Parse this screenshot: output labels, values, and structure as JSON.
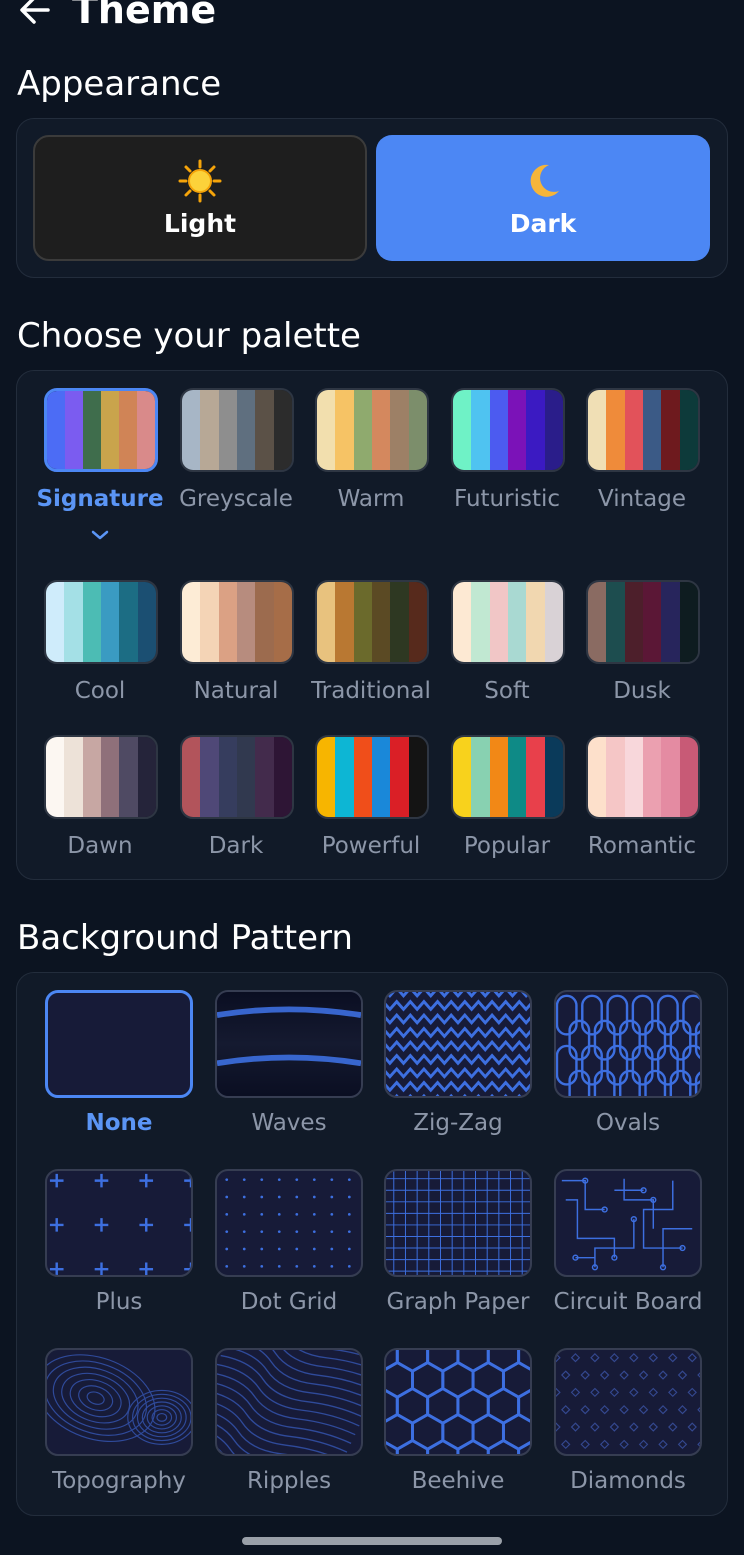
{
  "header": {
    "title": "Theme",
    "back_icon": "arrow-left-icon"
  },
  "appearance": {
    "title": "Appearance",
    "options": [
      {
        "label": "Light",
        "icon": "sun-icon",
        "selected": false
      },
      {
        "label": "Dark",
        "icon": "crescent-moon-icon",
        "selected": true
      }
    ]
  },
  "palette": {
    "title": "Choose your palette",
    "items": [
      {
        "label": "Signature",
        "selected": true,
        "colors": [
          "#4c6cf5",
          "#7b5cf0",
          "#3f6d4c",
          "#c9a44c",
          "#d08456",
          "#d98a8a"
        ]
      },
      {
        "label": "Greyscale",
        "colors": [
          "#a7b6c6",
          "#b7a896",
          "#8e8e8e",
          "#5f6f7f",
          "#5b5147",
          "#2c2c2c"
        ]
      },
      {
        "label": "Warm",
        "colors": [
          "#f2dfae",
          "#f6c365",
          "#8faa6e",
          "#d4885e",
          "#9d8066",
          "#7c8e6b"
        ]
      },
      {
        "label": "Futuristic",
        "colors": [
          "#6ff2c6",
          "#4fc3f1",
          "#4c5bf0",
          "#7b12b8",
          "#3b1ac2",
          "#2a1d8a"
        ]
      },
      {
        "label": "Vintage",
        "colors": [
          "#f0dfb5",
          "#ef8b3a",
          "#e2525a",
          "#3b5a86",
          "#6e1a1e",
          "#0d3a3a"
        ]
      },
      {
        "label": "Cool",
        "colors": [
          "#cfecfb",
          "#a4e0e6",
          "#4cbcb4",
          "#3a9bc2",
          "#1c6d84",
          "#1b4f72"
        ]
      },
      {
        "label": "Natural",
        "colors": [
          "#fdecd6",
          "#f4d4b6",
          "#dba184",
          "#b78c7e",
          "#9c6b4e",
          "#a66d48"
        ]
      },
      {
        "label": "Traditional",
        "colors": [
          "#e8c27e",
          "#b97832",
          "#6b6a2c",
          "#5b4a24",
          "#2e3822",
          "#572a1c"
        ]
      },
      {
        "label": "Soft",
        "colors": [
          "#fde9d3",
          "#c1e8d2",
          "#f1c6c6",
          "#a9d9d2",
          "#f1d7b0",
          "#d9d2d6"
        ]
      },
      {
        "label": "Dusk",
        "colors": [
          "#8a6b62",
          "#1d4d4f",
          "#4d1f2b",
          "#5b1736",
          "#27255c",
          "#0e1c20"
        ]
      },
      {
        "label": "Dawn",
        "colors": [
          "#fcf7f2",
          "#ede2d8",
          "#c7a7a3",
          "#8f707a",
          "#4f4a63",
          "#25243a"
        ]
      },
      {
        "label": "Dark",
        "colors": [
          "#b2545b",
          "#4f4877",
          "#363d5e",
          "#31394f",
          "#432b4c",
          "#2e1535"
        ]
      },
      {
        "label": "Powerful",
        "colors": [
          "#f7b500",
          "#0db6d4",
          "#f04e1a",
          "#1a88d9",
          "#da1f26",
          "#141414"
        ]
      },
      {
        "label": "Popular",
        "colors": [
          "#f8d21c",
          "#88d1b1",
          "#f28816",
          "#0e8a86",
          "#e8404b",
          "#0a3a5a"
        ]
      },
      {
        "label": "Romantic",
        "colors": [
          "#fde0cb",
          "#f5c6c6",
          "#f8d7db",
          "#eba0b0",
          "#e48ba2",
          "#c85a76"
        ]
      }
    ]
  },
  "pattern": {
    "title": "Background Pattern",
    "items": [
      {
        "label": "None",
        "selected": true
      },
      {
        "label": "Waves"
      },
      {
        "label": "Zig-Zag"
      },
      {
        "label": "Ovals"
      },
      {
        "label": "Plus"
      },
      {
        "label": "Dot Grid"
      },
      {
        "label": "Graph Paper"
      },
      {
        "label": "Circuit Board"
      },
      {
        "label": "Topography"
      },
      {
        "label": "Ripples"
      },
      {
        "label": "Beehive"
      },
      {
        "label": "Diamonds"
      }
    ]
  },
  "colors": {
    "accent": "#4c87f4",
    "background": "#0c1421",
    "card": "#111a28",
    "pattern_bg": "#171b38",
    "pattern_line": "#3d6fe0"
  }
}
